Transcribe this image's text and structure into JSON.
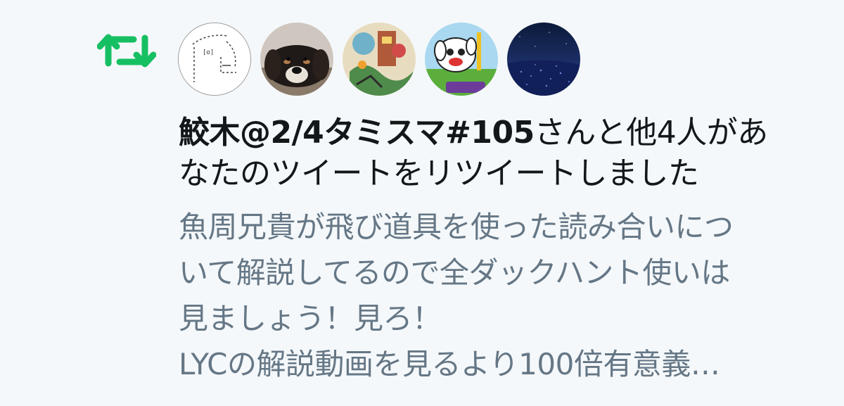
{
  "notification": {
    "type_icon": "retweet-icon",
    "accent_color": "#17bf63",
    "user_name": "鮫木@2/4タミスマ#105",
    "action_line_1_suffix": "さんと他4人があ",
    "action_line_2": "なたのツイートをリツイートしました",
    "avatars": [
      {
        "icon": "ascii-face-avatar"
      },
      {
        "icon": "dog-avatar"
      },
      {
        "icon": "illustration-avatar"
      },
      {
        "icon": "cartoon-dog-avatar"
      },
      {
        "icon": "night-sky-avatar"
      }
    ]
  },
  "tweet": {
    "lines": [
      "魚周兄貴が飛び道具を使った読み合いにつ",
      "いて解説してるので全ダックハント使いは",
      "見ましょう！見ろ！",
      "LYCの解説動画を見るより100倍有意義…"
    ]
  }
}
